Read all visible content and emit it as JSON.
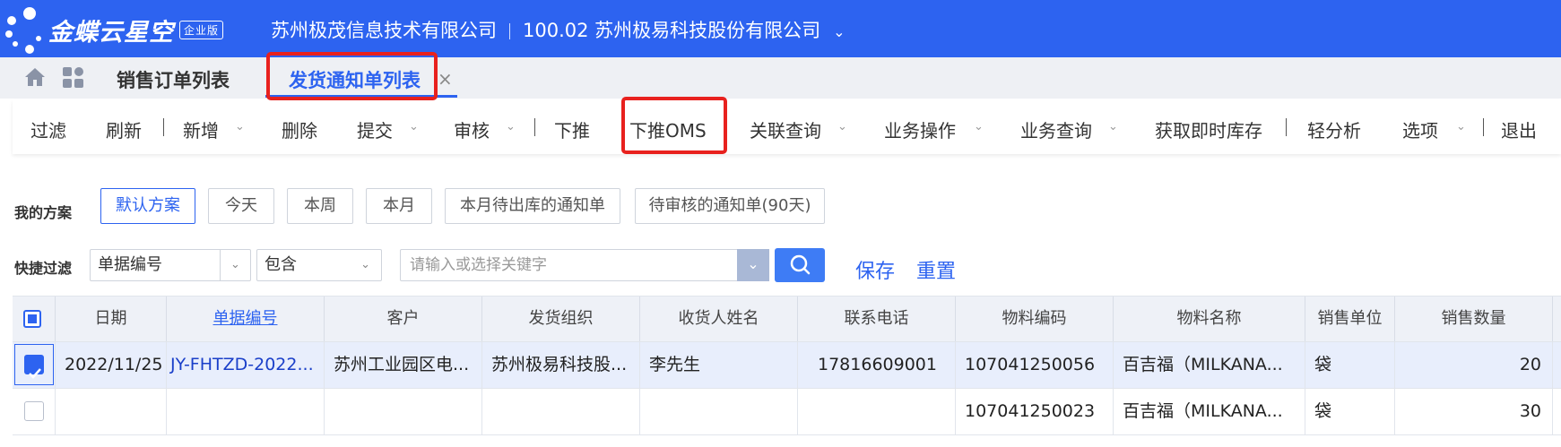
{
  "header": {
    "brand": "金蝶云星空",
    "edition": "企业版",
    "org1": "苏州极茂信息技术有限公司",
    "org2": "100.02 苏州极易科技股份有限公司"
  },
  "tabs": [
    {
      "label": "销售订单列表"
    },
    {
      "label": "发货通知单列表",
      "active": true
    }
  ],
  "toolbar": {
    "filter": "过滤",
    "refresh": "刷新",
    "new": "新增",
    "delete": "删除",
    "submit": "提交",
    "audit": "审核",
    "push_down": "下推",
    "push_oms": "下推OMS",
    "related_query": "关联查询",
    "business_ops": "业务操作",
    "business_query": "业务查询",
    "instant_stock": "获取即时库存",
    "light_analysis": "轻分析",
    "options": "选项",
    "exit": "退出"
  },
  "scheme": {
    "label": "我的方案",
    "buttons": [
      "默认方案",
      "今天",
      "本周",
      "本月",
      "本月待出库的通知单",
      "待审核的通知单(90天)"
    ]
  },
  "quick_filter": {
    "label": "快捷过滤",
    "field": "单据编号",
    "operator": "包含",
    "placeholder": "请输入或选择关键字",
    "save": "保存",
    "reset": "重置"
  },
  "table": {
    "columns": [
      "日期",
      "单据编号",
      "客户",
      "发货组织",
      "收货人姓名",
      "联系电话",
      "物料编码",
      "物料名称",
      "销售单位",
      "销售数量"
    ],
    "rows": [
      {
        "checked": true,
        "date": "2022/11/25",
        "bill_no": "JY-FHTZD-2022...",
        "customer": "苏州工业园区电...",
        "org": "苏州极易科技股...",
        "receiver": "李先生",
        "phone": "17816609001",
        "material_code": "107041250056",
        "material_name": "百吉福（MILKANA...",
        "unit": "袋",
        "qty": "20"
      },
      {
        "checked": false,
        "date": "",
        "bill_no": "",
        "customer": "",
        "org": "",
        "receiver": "",
        "phone": "",
        "material_code": "107041250023",
        "material_name": "百吉福（MILKANA...",
        "unit": "袋",
        "qty": "30"
      }
    ]
  },
  "colors": {
    "brand_blue": "#2d63f0",
    "highlight_red": "#e8211e"
  }
}
